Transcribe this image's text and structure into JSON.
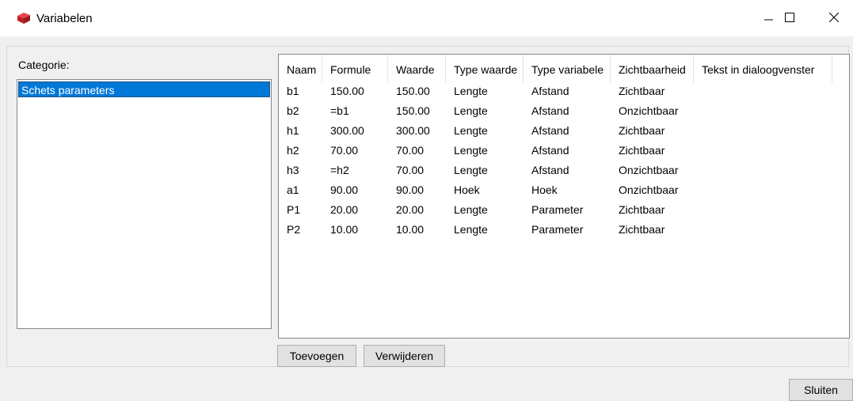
{
  "window": {
    "title": "Variabelen",
    "icons": {
      "app": "red-book-icon",
      "minimize": "minimize-icon",
      "maximize": "maximize-icon",
      "close": "close-icon"
    }
  },
  "category": {
    "label": "Categorie:",
    "items": [
      "Schets parameters"
    ],
    "selected": "Schets parameters"
  },
  "table": {
    "headers": [
      "Naam",
      "Formule",
      "Waarde",
      "Type waarde",
      "Type variabele",
      "Zichtbaarheid",
      "Tekst in dialoogvenster"
    ],
    "rows": [
      [
        "b1",
        "150.00",
        "150.00",
        "Lengte",
        "Afstand",
        "Zichtbaar",
        ""
      ],
      [
        "b2",
        "=b1",
        "150.00",
        "Lengte",
        "Afstand",
        "Onzichtbaar",
        ""
      ],
      [
        "h1",
        "300.00",
        "300.00",
        "Lengte",
        "Afstand",
        "Zichtbaar",
        ""
      ],
      [
        "h2",
        "70.00",
        "70.00",
        "Lengte",
        "Afstand",
        "Zichtbaar",
        ""
      ],
      [
        "h3",
        "=h2",
        "70.00",
        "Lengte",
        "Afstand",
        "Onzichtbaar",
        ""
      ],
      [
        "a1",
        "90.00",
        "90.00",
        "Hoek",
        "Hoek",
        "Onzichtbaar",
        ""
      ],
      [
        "P1",
        "20.00",
        "20.00",
        "Lengte",
        "Parameter",
        "Zichtbaar",
        ""
      ],
      [
        "P2",
        "10.00",
        "10.00",
        "Lengte",
        "Parameter",
        "Zichtbaar",
        ""
      ]
    ]
  },
  "buttons": {
    "add": "Toevoegen",
    "remove": "Verwijderen",
    "close": "Sluiten"
  },
  "colors": {
    "selection": "#0078d7",
    "app_icon": "#d9262c"
  }
}
